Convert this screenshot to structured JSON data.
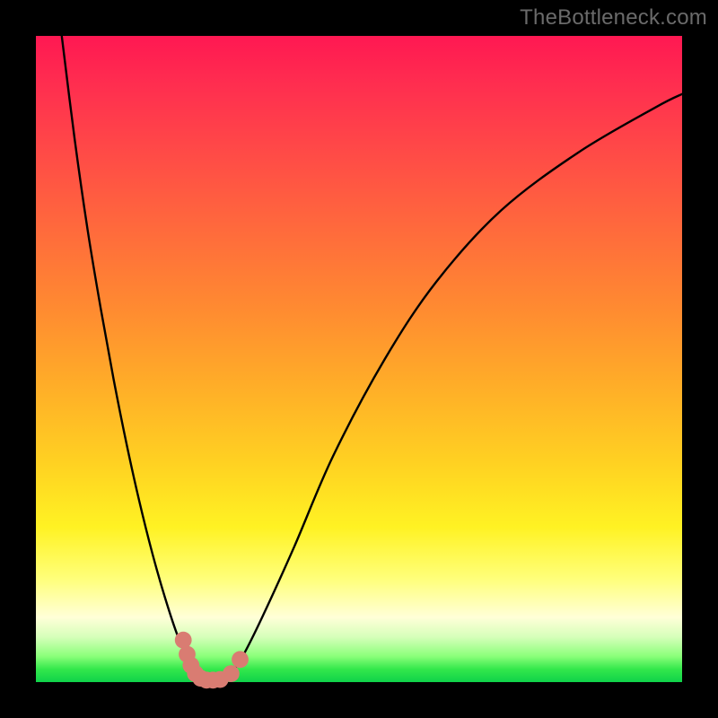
{
  "watermark": "TheBottleneck.com",
  "colors": {
    "frame": "#000000",
    "curve": "#000000",
    "marker": "#d97c72",
    "gradient_stops": [
      "#ff1852",
      "#ff2f4f",
      "#ff4a47",
      "#ff6a3c",
      "#ff8a31",
      "#ffad28",
      "#ffd122",
      "#fff223",
      "#ffff7a",
      "#ffffd8",
      "#d6ffba",
      "#8bff7a",
      "#33e84b",
      "#0fd24a"
    ]
  },
  "chart_data": {
    "type": "line",
    "title": "",
    "xlabel": "",
    "ylabel": "",
    "xlim": [
      0,
      100
    ],
    "ylim": [
      0,
      100
    ],
    "grid": false,
    "legend": false,
    "series": [
      {
        "name": "bottleneck-curve",
        "x": [
          4,
          6,
          8,
          10,
          12,
          14,
          16,
          18,
          20,
          22,
          23.5,
          25,
          26,
          27,
          28,
          29,
          30,
          32,
          35,
          40,
          46,
          54,
          62,
          72,
          84,
          96,
          100
        ],
        "y": [
          100,
          84,
          70,
          58,
          47,
          37,
          28,
          20,
          13,
          7,
          4,
          2,
          1,
          0,
          0,
          0,
          1,
          4,
          10,
          21,
          35,
          50,
          62,
          73,
          82,
          89,
          91
        ]
      }
    ],
    "markers": [
      {
        "x": 22.8,
        "y": 6.5
      },
      {
        "x": 23.4,
        "y": 4.3
      },
      {
        "x": 24.0,
        "y": 2.6
      },
      {
        "x": 24.7,
        "y": 1.3
      },
      {
        "x": 25.5,
        "y": 0.6
      },
      {
        "x": 26.4,
        "y": 0.3
      },
      {
        "x": 27.4,
        "y": 0.3
      },
      {
        "x": 28.5,
        "y": 0.4
      },
      {
        "x": 30.2,
        "y": 1.3
      },
      {
        "x": 31.6,
        "y": 3.5
      }
    ],
    "marker_radius": 1.3
  }
}
